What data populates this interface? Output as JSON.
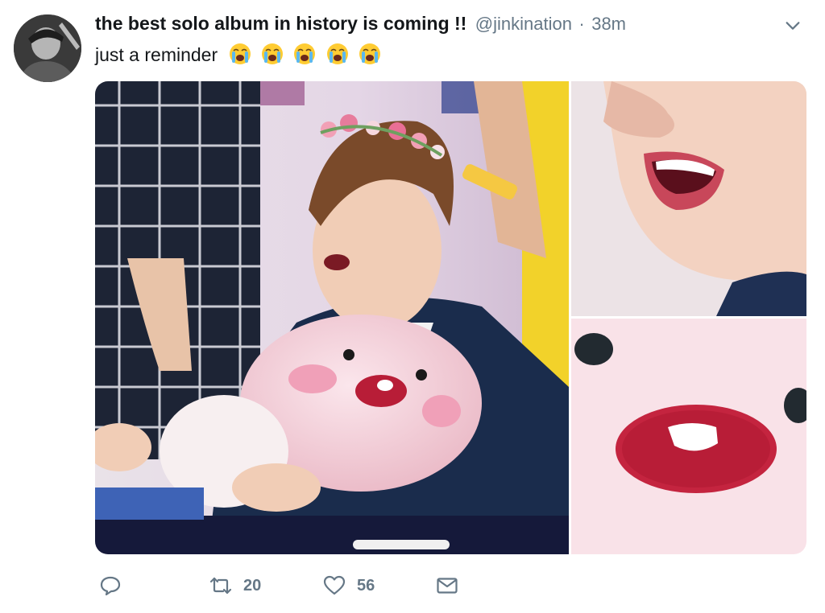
{
  "tweet": {
    "display_name": "the best solo album in history is coming !!",
    "handle": "@jinkination",
    "separator": "·",
    "time": "38m",
    "text": "just a reminder",
    "emoji": [
      "loudly-crying-face",
      "loudly-crying-face",
      "loudly-crying-face",
      "loudly-crying-face",
      "loudly-crying-face"
    ]
  },
  "actions": {
    "reply_icon": "reply-icon",
    "retweet_count": "20",
    "like_count": "56",
    "dm_icon": "envelope-icon"
  },
  "colors": {
    "text": "#14171a",
    "secondary": "#657786",
    "background": "#ffffff"
  }
}
